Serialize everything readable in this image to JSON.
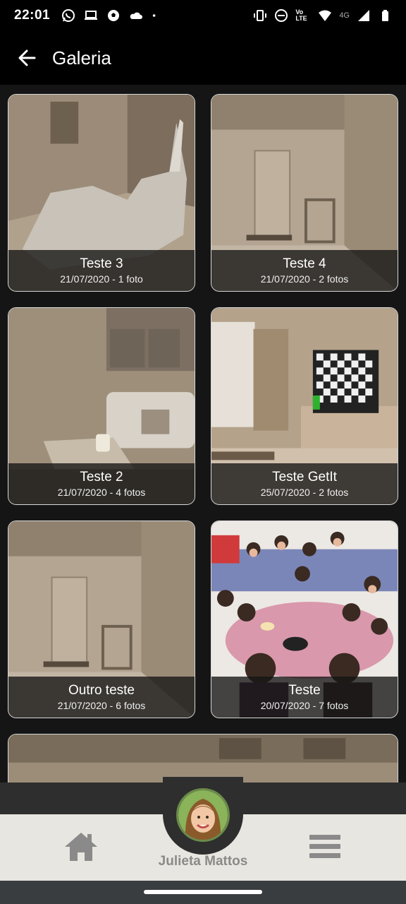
{
  "status_bar": {
    "time": "22:01",
    "left_icons": [
      "whatsapp-icon",
      "laptop-icon",
      "soccer-ball-icon",
      "cloud-icon",
      "dot-icon"
    ],
    "right_icons": [
      "vibrate-icon",
      "do-not-disturb-icon",
      "volte-icon",
      "wifi-icon",
      "signal-4g-icon",
      "battery-icon"
    ],
    "network_label": "4G",
    "volte_label": "Vo LTE"
  },
  "app_bar": {
    "title": "Galeria"
  },
  "albums": [
    {
      "title": "Teste 3",
      "meta": "21/07/2020 - 1 foto",
      "thumb": "room-dog-render"
    },
    {
      "title": "Teste 4",
      "meta": "21/07/2020 - 2 fotos",
      "thumb": "room-door-render"
    },
    {
      "title": "Teste 2",
      "meta": "21/07/2020 - 4 fotos",
      "thumb": "room-sofa-render"
    },
    {
      "title": "Teste GetIt",
      "meta": "25/07/2020 - 2 fotos",
      "thumb": "room-tv-render"
    },
    {
      "title": "Outro teste",
      "meta": "21/07/2020 - 6 fotos",
      "thumb": "room-door-render"
    },
    {
      "title": "Teste",
      "meta": "20/07/2020 - 7 fotos",
      "thumb": "kids-party-photo"
    }
  ],
  "bottom_nav": {
    "user_name": "Julieta Mattos",
    "home_icon": "home-icon",
    "menu_icon": "menu-icon"
  },
  "colors": {
    "background": "#151515",
    "app_bar": "#000000",
    "card_border": "#d8d8d8",
    "bottom_nav": "#e8e6e0",
    "nav_icon": "#8a8a8a"
  }
}
